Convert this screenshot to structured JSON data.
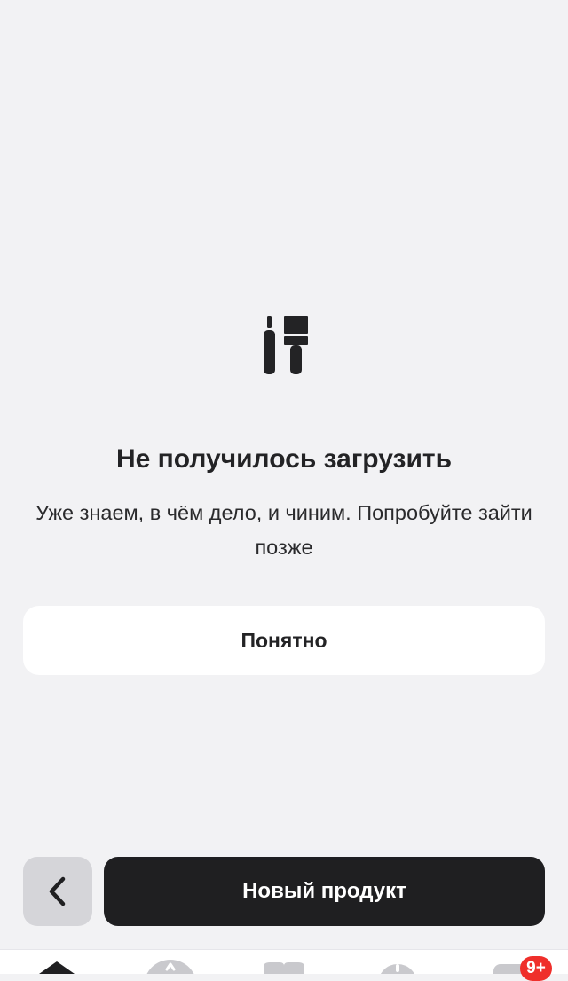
{
  "error": {
    "icon": "tools-icon",
    "title": "Не получилось загрузить",
    "message": "Уже знаем, в чём дело, и чиним. Попробуйте зайти позже",
    "button_label": "Понятно"
  },
  "bottom_actions": {
    "back_icon": "chevron-left-icon",
    "primary_label": "Новый продукт"
  },
  "tab_bar": {
    "items": [
      {
        "icon": "home-icon"
      },
      {
        "icon": "payments-icon"
      },
      {
        "icon": "favorites-icon"
      },
      {
        "icon": "history-icon"
      },
      {
        "icon": "chat-icon"
      }
    ],
    "badge": "9+"
  },
  "colors": {
    "background": "#f2f2f4",
    "primary_button": "#1f1f21",
    "secondary_button": "#d5d5d9",
    "badge": "#ef2f2b"
  }
}
